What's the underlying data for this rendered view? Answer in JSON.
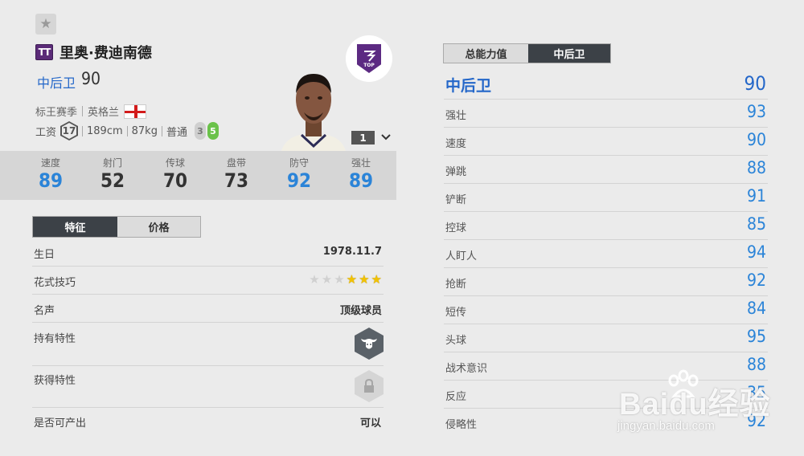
{
  "player": {
    "season_badge": "TT",
    "name": "里奥·费迪南德",
    "position": "中后卫",
    "position_ovr": "90",
    "season": "标王赛季",
    "nation": "英格兰",
    "wage_label": "工资",
    "wage": "17",
    "height": "189cm",
    "weight": "87kg",
    "body_type": "普通",
    "weak_foot": "3",
    "strong_foot": "5",
    "level": "1",
    "club_badge_text": "TOP"
  },
  "key_stats": [
    {
      "label": "速度",
      "value": "89",
      "color": "blue"
    },
    {
      "label": "射门",
      "value": "52",
      "color": "dark"
    },
    {
      "label": "传球",
      "value": "70",
      "color": "dark"
    },
    {
      "label": "盘带",
      "value": "73",
      "color": "dark"
    },
    {
      "label": "防守",
      "value": "92",
      "color": "blue"
    },
    {
      "label": "强壮",
      "value": "89",
      "color": "blue"
    }
  ],
  "left_tabs": [
    "特征",
    "价格"
  ],
  "details": {
    "birthday_label": "生日",
    "birthday": "1978.11.7",
    "skill_label": "花式技巧",
    "skill_stars": 3,
    "skill_stars_max": 5,
    "reputation_label": "名声",
    "reputation": "顶级球员",
    "own_trait_label": "持有特性",
    "own_trait_icon": "buffalo-icon",
    "earn_trait_label": "获得特性",
    "earn_trait_icon": "lock-icon",
    "producible_label": "是否可产出",
    "producible": "可以"
  },
  "right_tabs": [
    "总能力值",
    "中后卫"
  ],
  "attributes_header": {
    "label": "中后卫",
    "value": "90"
  },
  "attributes": [
    {
      "label": "强壮",
      "value": "93"
    },
    {
      "label": "速度",
      "value": "90"
    },
    {
      "label": "弹跳",
      "value": "88"
    },
    {
      "label": "铲断",
      "value": "91"
    },
    {
      "label": "控球",
      "value": "85"
    },
    {
      "label": "人盯人",
      "value": "94"
    },
    {
      "label": "抢断",
      "value": "92"
    },
    {
      "label": "短传",
      "value": "84"
    },
    {
      "label": "头球",
      "value": "95"
    },
    {
      "label": "战术意识",
      "value": "88"
    },
    {
      "label": "反应",
      "value": "35"
    },
    {
      "label": "侵略性",
      "value": "92"
    }
  ],
  "watermark": {
    "main": "Baidu经验",
    "sub": "jingyan.baidu.com"
  },
  "colors": {
    "accent_blue": "#2467c9",
    "stat_blue": "#2b84d8",
    "tab_active": "#3c4147",
    "season_purple": "#5b2b78",
    "strong_foot_green": "#6ac24a"
  }
}
